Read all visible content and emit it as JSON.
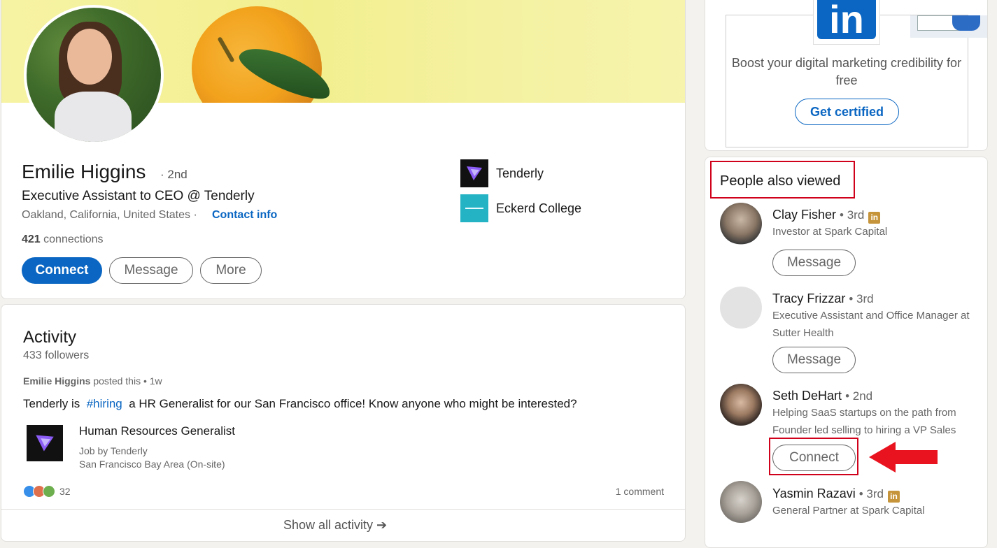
{
  "profile": {
    "name": "Emilie Higgins",
    "degree": "· 2nd",
    "headline": "Executive Assistant to CEO @ Tenderly",
    "location": "Oakland, California, United States ·",
    "contact_info": "Contact info",
    "connections_count": "421",
    "connections_label": "connections",
    "buttons": {
      "connect": "Connect",
      "message": "Message",
      "more": "More"
    },
    "orgs": [
      {
        "name": "Tenderly"
      },
      {
        "name": "Eckerd College"
      }
    ]
  },
  "activity": {
    "title": "Activity",
    "followers": "433 followers",
    "post_author": "Emilie Higgins",
    "post_meta_rest": "posted this • 1w",
    "post_text_start": "Tenderly is",
    "post_hashtag": "#hiring",
    "post_text_end": "a HR Generalist for our San Francisco office! Know anyone who might be interested?",
    "job_title": "Human Resources Generalist",
    "job_company": "Job by Tenderly",
    "job_location": "San Francisco Bay Area (On-site)",
    "reaction_count": "32",
    "comment_count": "1 comment",
    "show_all": "Show all activity ➔"
  },
  "ad": {
    "logo_text": "in",
    "text": "Boost your digital marketing credibility for free",
    "button": "Get certified"
  },
  "people_also_viewed": {
    "title": "People also viewed",
    "people": [
      {
        "name": "Clay Fisher",
        "degree": "• 3rd",
        "line1": "Investor at Spark Capital",
        "line2": "",
        "button": "Message"
      },
      {
        "name": "Tracy Frizzar",
        "degree": "• 3rd",
        "line1": "Executive Assistant and Office Manager at",
        "line2": "Sutter Health",
        "button": "Message"
      },
      {
        "name": "Seth DeHart",
        "degree": "• 2nd",
        "line1": "Helping SaaS startups on the path from",
        "line2": "Founder led selling to hiring a VP Sales",
        "button": "Connect"
      },
      {
        "name": "Yasmin Razavi",
        "degree": "• 3rd",
        "line1": "General Partner at Spark Capital",
        "line2": "",
        "button": ""
      }
    ]
  },
  "colors": {
    "brand_blue": "#0a66c2",
    "highlight_red": "#d0021b",
    "linkedin_premium_gold": "#c6953b"
  }
}
